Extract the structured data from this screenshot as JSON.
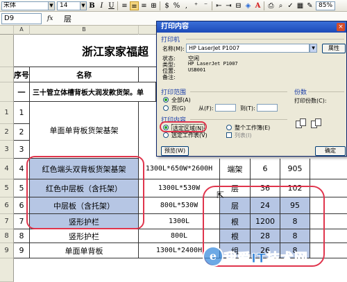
{
  "toolbar": {
    "font_name": "宋体",
    "font_size": "14",
    "bold": "B",
    "italic": "I",
    "underline": "U",
    "currency": "%",
    "zoom": "85%"
  },
  "formula_bar": {
    "name_box": "D9",
    "fx": "fx",
    "content": "层"
  },
  "columns": [
    "A",
    "B"
  ],
  "rows": [
    {
      "num": "",
      "seq": "",
      "name": "",
      "spec": "",
      "unit": "",
      "qty": "",
      "price": ""
    },
    {
      "num": "",
      "seq": "序号",
      "name": "名称",
      "spec": "",
      "unit": "",
      "qty": "",
      "price": ""
    },
    {
      "num": "",
      "seq": "一",
      "name": "三十管立体槽背板大润发款货架。单",
      "spec": "",
      "unit": "",
      "qty": "",
      "price": ""
    },
    {
      "num": "1",
      "seq": "1",
      "name": "",
      "spec": "",
      "unit": "",
      "qty": "",
      "price": ""
    },
    {
      "num": "2",
      "seq": "2",
      "name": "单面单背板货架基架",
      "spec": "",
      "unit": "",
      "qty": "",
      "price": ""
    },
    {
      "num": "3",
      "seq": "3",
      "name": "",
      "spec": "",
      "unit": "",
      "qty": "",
      "price": ""
    },
    {
      "num": "4",
      "seq": "4",
      "name": "红色端头双背板货架基架",
      "spec": "1300L*650W*2600H",
      "unit": "端架",
      "qty": "6",
      "price": "905"
    },
    {
      "num": "5",
      "seq": "5",
      "name": "红色中层板（含托架）",
      "spec": "1300L*530W",
      "unit": "层",
      "qty": "36",
      "price": "102"
    },
    {
      "num": "6",
      "seq": "6",
      "name": "中层板（含托架）",
      "spec": "800L*530W",
      "unit": "层",
      "qty": "24",
      "price": "95"
    },
    {
      "num": "7",
      "seq": "7",
      "name": "竖形护栏",
      "spec": "1300L",
      "unit": "根",
      "qty": "1200",
      "price": "8"
    },
    {
      "num": "8",
      "seq": "8",
      "name": "竖形护栏",
      "spec": "800L",
      "unit": "根",
      "qty": "28",
      "price": "8"
    },
    {
      "num": "9",
      "seq": "9",
      "name": "单面单背板",
      "spec": "1300L*2400H",
      "unit": "组",
      "qty": "26",
      "price": "8"
    }
  ],
  "sheet_title": "浙江家家福超",
  "dialog": {
    "title": "打印内容",
    "close": "×",
    "printer_group": "打印机",
    "name_label": "名称(M):",
    "printer_name": "HP LaserJet P1007",
    "properties_button": "属性",
    "status_label": "状态:",
    "status_value": "空闲",
    "type_label": "类型:",
    "type_value": "HP LaserJet P1007",
    "where_label": "位置:",
    "where_value": "USB001",
    "comment_label": "备注:",
    "range_group": "打印范围",
    "range_all": "全部(A)",
    "range_pages": "页(G)",
    "from_label": "从(F):",
    "to_label": "到(T):",
    "content_group": "打印内容",
    "content_selection": "选定区域(N)",
    "content_workbook": "整个工作簿(E)",
    "content_active": "选定工作表(V)",
    "content_list": "列表(I)",
    "copies_group": "份数",
    "copies_label": "打印份数(C):",
    "preview_button": "预览(W)",
    "ok_button": "确定"
  },
  "watermark": {
    "logo": "e",
    "text": "我爱IT技术网"
  },
  "colors": {
    "selection": "#b6c6e4",
    "annotation": "#e0344c",
    "dialog_title": "#1c4ab8"
  }
}
